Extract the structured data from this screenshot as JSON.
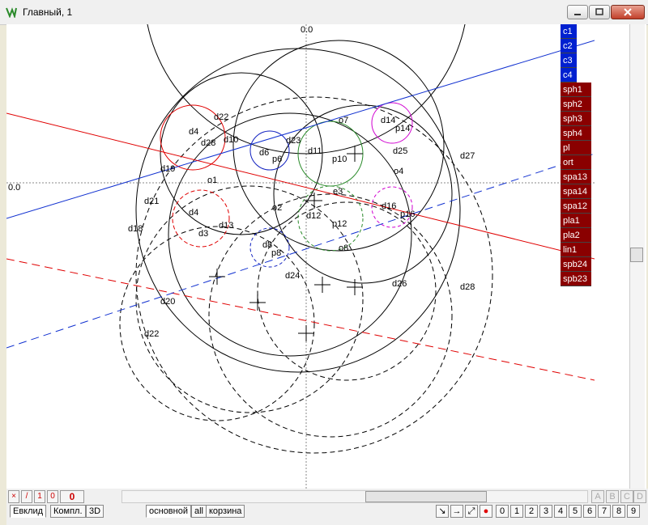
{
  "window": {
    "title": "Главный, 1"
  },
  "canvas": {
    "axis_labels": {
      "top": "0.0",
      "left": "0.0"
    },
    "labels": [
      "d22",
      "d4",
      "d28",
      "d10",
      "d23",
      "d14",
      "p14",
      "o7",
      "d11",
      "p10",
      "p6",
      "d6",
      "d25",
      "d27",
      "d19",
      "o1",
      "o4",
      "e3",
      "d21",
      "d18",
      "d4",
      "d13",
      "d12",
      "p12",
      "d16",
      "p16",
      "o2",
      "d3",
      "d8",
      "p8",
      "o8",
      "d24",
      "d26",
      "d28",
      "d20",
      "d22"
    ]
  },
  "object_list": {
    "blue": [
      "c1",
      "c2",
      "c3",
      "c4"
    ],
    "red": [
      "sph1",
      "sph2",
      "sph3",
      "sph4",
      "pl",
      "ort",
      "spa13",
      "spa14",
      "spa12",
      "pla1",
      "pla2",
      "lin1",
      "spb24",
      "spb23"
    ]
  },
  "bottom": {
    "small_buttons": [
      "×",
      "/",
      "1",
      "0",
      "0"
    ],
    "tabs": [
      "Евклид",
      "Компл.",
      "3D"
    ],
    "sheet_tabs": [
      "основной",
      "all",
      "корзина"
    ],
    "letters": [
      "A",
      "B",
      "C",
      "D"
    ],
    "digits": [
      "0",
      "1",
      "2",
      "3",
      "4",
      "5",
      "6",
      "7",
      "8",
      "9"
    ]
  },
  "colors": {
    "accent_blue": "#0020d0",
    "accent_red": "#8a0000"
  }
}
